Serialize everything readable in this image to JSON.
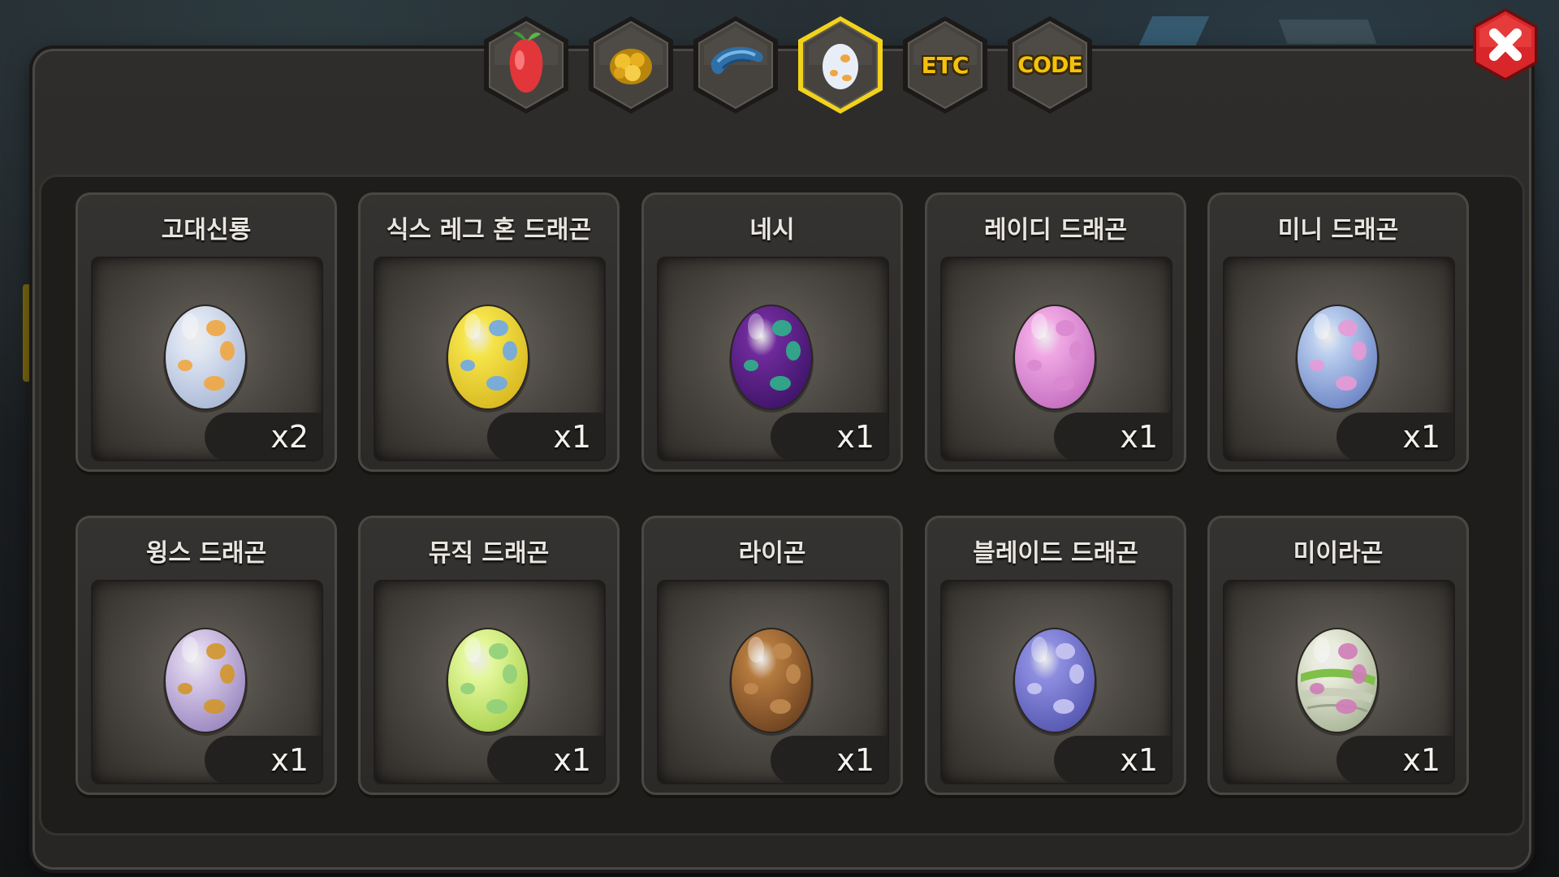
{
  "tabs": [
    {
      "id": "fruit",
      "icon": "red-fruit-icon",
      "label": "",
      "active": false
    },
    {
      "id": "gold",
      "icon": "gold-ore-icon",
      "label": "",
      "active": false
    },
    {
      "id": "scale",
      "icon": "blue-scale-icon",
      "label": "",
      "active": false
    },
    {
      "id": "egg",
      "icon": "egg-icon",
      "label": "",
      "active": true
    },
    {
      "id": "etc",
      "icon": "",
      "label": "ETC",
      "active": false
    },
    {
      "id": "code",
      "icon": "",
      "label": "CODE",
      "active": false
    }
  ],
  "close_icon": "close-icon",
  "items": [
    {
      "name": "고대신룡",
      "qty": "x2",
      "egg": {
        "base": "#dfe6f2",
        "shade": "#a9b8d6",
        "spot": "#f0a640"
      }
    },
    {
      "name": "식스 레그 혼 드래곤",
      "qty": "x1",
      "egg": {
        "base": "#f5e44a",
        "shade": "#d8b720",
        "spot": "#6ea8e8"
      }
    },
    {
      "name": "네시",
      "qty": "x1",
      "egg": {
        "base": "#6e2a9a",
        "shade": "#3e1468",
        "spot": "#2fb28a"
      }
    },
    {
      "name": "레이디 드래곤",
      "qty": "x1",
      "egg": {
        "base": "#f0a8e4",
        "shade": "#c46dc0",
        "spot": "#d988d0"
      }
    },
    {
      "name": "미니 드래곤",
      "qty": "x1",
      "egg": {
        "base": "#b9cdee",
        "shade": "#6b84c4",
        "spot": "#e79ad6"
      }
    },
    {
      "name": "윙스 드래곤",
      "qty": "x1",
      "egg": {
        "base": "#d9cdea",
        "shade": "#9a86c0",
        "spot": "#d0962a"
      }
    },
    {
      "name": "뮤직 드래곤",
      "qty": "x1",
      "egg": {
        "base": "#e3f79a",
        "shade": "#a9d24e",
        "spot": "#8fcf7a"
      }
    },
    {
      "name": "라이곤",
      "qty": "x1",
      "egg": {
        "base": "#b47a3e",
        "shade": "#6e4220",
        "spot": "#c08a50"
      }
    },
    {
      "name": "블레이드 드래곤",
      "qty": "x1",
      "egg": {
        "base": "#8d8ee0",
        "shade": "#5456b0",
        "spot": "#c9c6f2"
      }
    },
    {
      "name": "미이라곤",
      "qty": "x1",
      "egg": {
        "base": "#e9ecdc",
        "shade": "#a8b496",
        "spot": "#cf7cb8",
        "band": "#7fbf4a"
      }
    }
  ]
}
